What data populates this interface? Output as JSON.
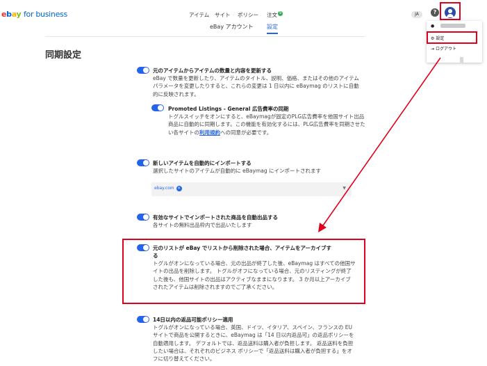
{
  "header": {
    "logo": {
      "e": "e",
      "b": "b",
      "a": "a",
      "y": "y",
      "biz": "for business"
    },
    "nav": [
      "アイテム",
      "サイト",
      "ポリシー",
      "注文"
    ],
    "order_badge": "9",
    "lang": "JA",
    "help": "?"
  },
  "subtabs": [
    "eBay アカウント",
    "設定"
  ],
  "page_title": "同期設定",
  "dropdown": {
    "settings": "設定",
    "logout": "ログアウト"
  },
  "sections": [
    {
      "title": "元のアイテムからアイテムの数量と内容を更新する",
      "desc": "eBay で数量を更新したり、アイテムのタイトル、説明、価格、またはその他のアイテム パラメータを変更したりすると、これらの変更は 1 日以内に eBaymag のリストに自動的に反映されます。"
    },
    {
      "title": "Promoted Listings - General 広告費率の同期",
      "desc_before": "トグルスイッチをオンにすると、eBaymagが固定のPLG広告費率を他国サイト出品商品に自動的に同期します。この機能を有効化するには、PLG広告費率を同期させたい各サイトの",
      "link": "利用規約",
      "desc_after": "への同意が必要です。"
    },
    {
      "title": "新しいアイテムを自動的にインポートする",
      "desc": "選択したサイトのアイテムが自動的に eBaymag にインポートされます",
      "select_value": "ebay.com"
    },
    {
      "title": "有効なサイトでインポートされた商品を自動出品する",
      "desc": "各サイトの無料出品枠内で出品いたします"
    },
    {
      "title_line1": "元のリストが eBay でリストから削除された場合、アイテムをアーカイブす",
      "title_line2": "る",
      "desc": "トグルがオンになっている場合、元の出品が終了した後、eBaymag はすべての他国サイトの出品を削除します。 トグルがオフになっている場合、元のリスティングが終了した後も、他国サイトの出品はアクティブなままになります。 3 か月以上アーカイブされたアイテムは削除されますのでご了承ください。"
    },
    {
      "title": "14日以内の返品可能ポリシー適用",
      "desc": "トグルがオンになっている場合、英国、ドイツ、イタリア、スペイン、フランスの EU サイトで商品を公開するときに、eBaymag は「14 日以内返品可」の返品ポリシーを自動適用します。 デフォルトでは、返品送料は購入者が負担します。 返品送料を負担したい場合は、それぞれのビジネス ポリシーで「返品送料は購入者が負担する」をオフに切り替えてください。"
    }
  ],
  "colors": {
    "accent": "#2563eb",
    "highlight": "#e0001b"
  }
}
